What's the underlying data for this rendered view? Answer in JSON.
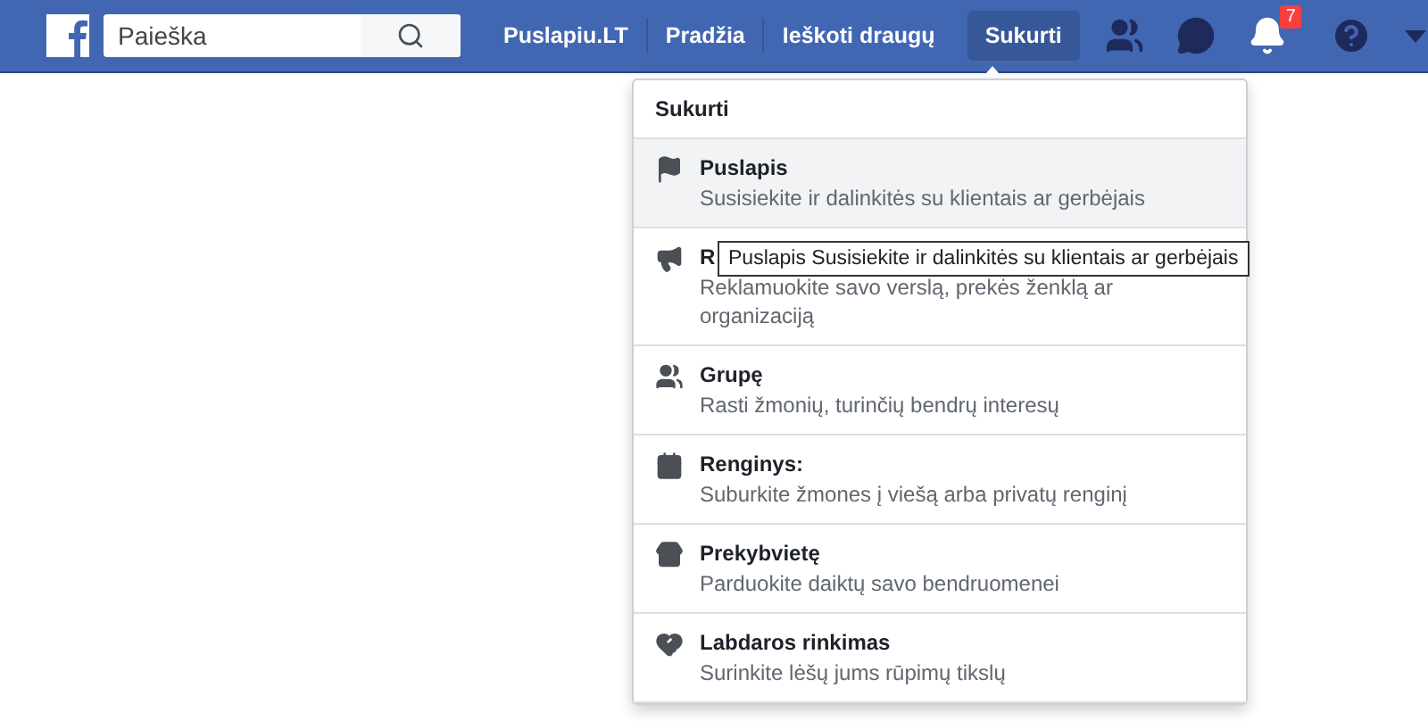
{
  "header": {
    "search": {
      "placeholder": "Paieška"
    },
    "nav": [
      {
        "label": "Puslapiu.LT",
        "selected": false
      },
      {
        "label": "Pradžia",
        "selected": false
      },
      {
        "label": "Ieškoti draugų",
        "selected": false
      },
      {
        "label": "Sukurti",
        "selected": true
      }
    ],
    "notifications_badge": "7"
  },
  "menu": {
    "title": "Sukurti",
    "items": [
      {
        "kind": "page",
        "title": "Puslapis",
        "description": "Susisiekite ir dalinkitės su klientais ar gerbėjais",
        "selected": true
      },
      {
        "kind": "ad",
        "title": "R",
        "description": "Reklamuokite savo verslą, prekės ženklą ar organizaciją",
        "selected": false
      },
      {
        "kind": "group",
        "title": "Grupę",
        "description": "Rasti žmonių, turinčių bendrų interesų",
        "selected": false
      },
      {
        "kind": "event",
        "title": "Renginys:",
        "description": "Suburkite žmones į viešą arba privatų renginį",
        "selected": false
      },
      {
        "kind": "marketplace",
        "title": "Prekybvietę",
        "description": "Parduokite daiktų savo bendruomenei",
        "selected": false
      },
      {
        "kind": "fundraiser",
        "title": "Labdaros rinkimas",
        "description": "Surinkite lėšų jums rūpimų tikslų",
        "selected": false
      }
    ]
  },
  "tooltip": "Puslapis Susisiekite ir dalinkitės su klientais ar gerbėjais"
}
